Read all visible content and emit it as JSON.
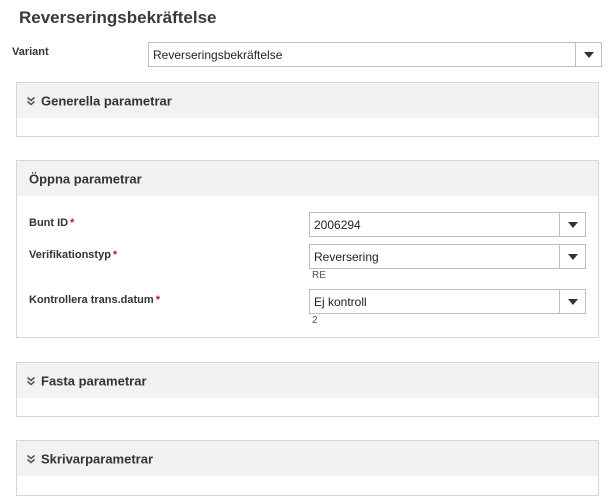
{
  "title": "Reverseringsbekräftelse",
  "variant": {
    "label": "Variant",
    "value": "Reverseringsbekräftelse"
  },
  "sections": {
    "general": {
      "title": "Generella parametrar"
    },
    "open": {
      "title": "Öppna parametrar",
      "fields": {
        "bunt": {
          "label": "Bunt ID",
          "required": "*",
          "value": "2006294"
        },
        "vertyp": {
          "label": "Verifikationstyp",
          "required": "*",
          "value": "Reversering",
          "code": "RE"
        },
        "kontroll": {
          "label": "Kontrollera trans.datum",
          "required": "*",
          "value": "Ej kontroll",
          "code": "2"
        }
      }
    },
    "fixed": {
      "title": "Fasta parametrar"
    },
    "printer": {
      "title": "Skrivarparametrar"
    }
  },
  "colors": {
    "required": "#c8102e",
    "panel_header": "#f2f2f2",
    "border": "#d6d6d6"
  }
}
